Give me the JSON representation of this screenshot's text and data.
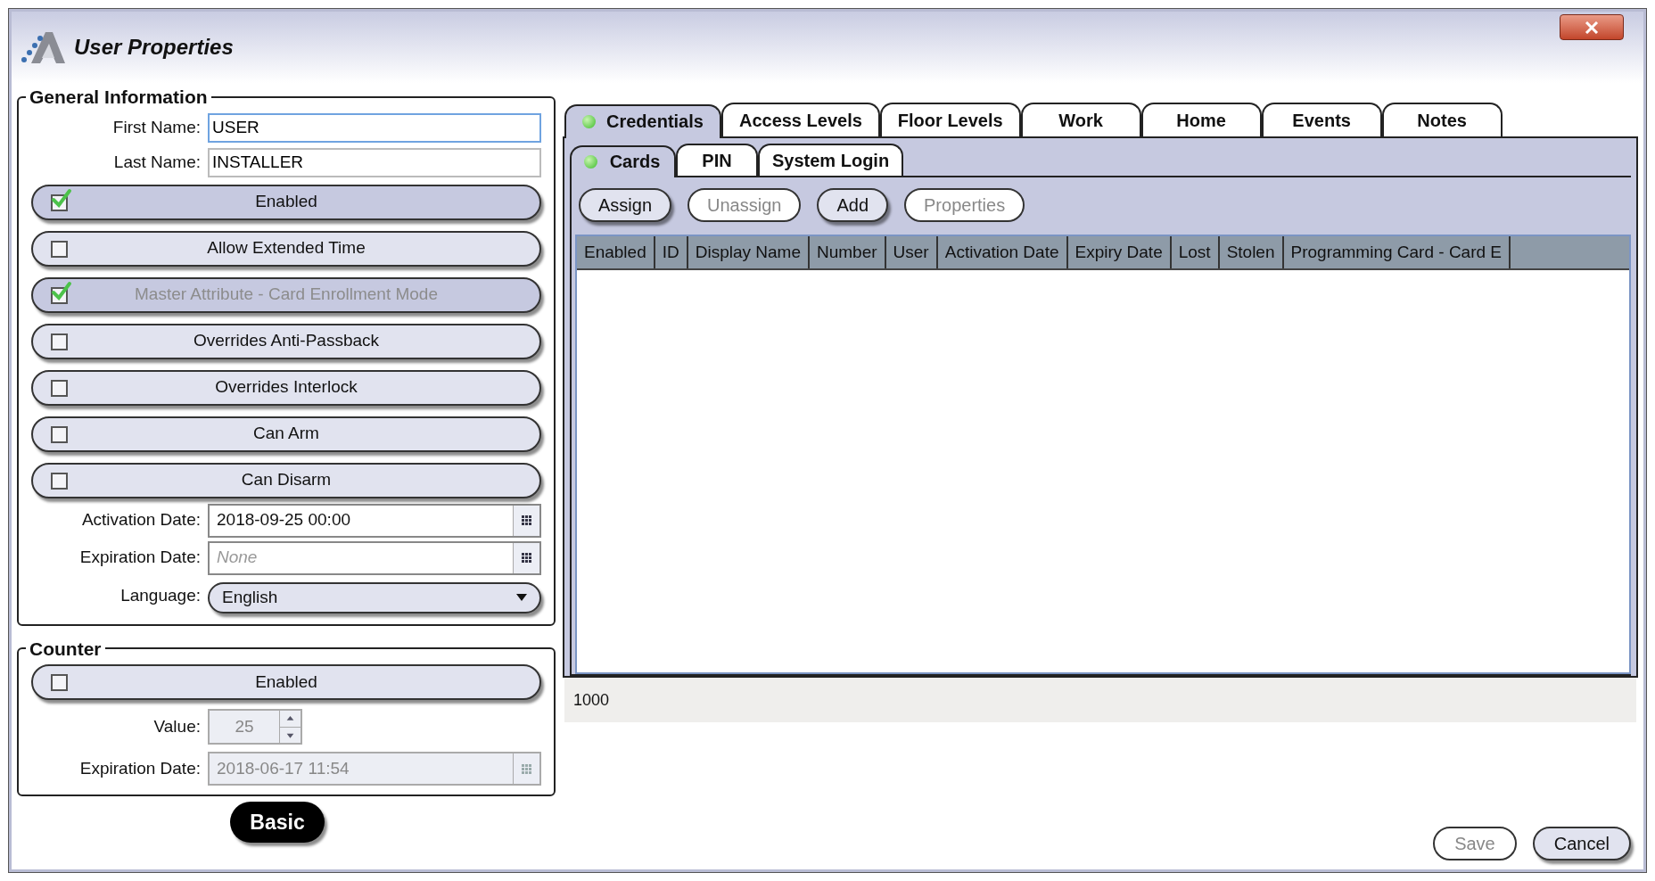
{
  "window": {
    "title": "User Properties"
  },
  "general_information": {
    "title": "General Information",
    "first_name": {
      "label": "First Name:",
      "value": "USER",
      "focused": true
    },
    "last_name": {
      "label": "Last Name:",
      "value": "INSTALLER",
      "focused": false
    },
    "toggles": [
      {
        "label": "Enabled",
        "checked": true,
        "disabled": false
      },
      {
        "label": "Allow Extended Time",
        "checked": false,
        "disabled": false
      },
      {
        "label": "Master Attribute - Card Enrollment Mode",
        "checked": true,
        "disabled": true
      },
      {
        "label": "Overrides Anti-Passback",
        "checked": false,
        "disabled": false
      },
      {
        "label": "Overrides Interlock",
        "checked": false,
        "disabled": false
      },
      {
        "label": "Can Arm",
        "checked": false,
        "disabled": false
      },
      {
        "label": "Can Disarm",
        "checked": false,
        "disabled": false
      }
    ],
    "activation_date": {
      "label": "Activation Date:",
      "value": "2018-09-25 00:00",
      "disabled": false
    },
    "expiration_date": {
      "label": "Expiration Date:",
      "placeholder": "None",
      "disabled": false
    },
    "language": {
      "label": "Language:",
      "value": "English"
    }
  },
  "counter": {
    "title": "Counter",
    "toggle": {
      "label": "Enabled",
      "checked": false,
      "disabled": false
    },
    "value": {
      "label": "Value:",
      "value": "25",
      "disabled": true
    },
    "expiration_date": {
      "label": "Expiration Date:",
      "value": "2018-06-17 11:54",
      "disabled": true
    }
  },
  "mode_button": {
    "label": "Basic"
  },
  "tabs": [
    {
      "label": "Credentials",
      "selected": true
    },
    {
      "label": "Access Levels",
      "selected": false
    },
    {
      "label": "Floor Levels",
      "selected": false
    },
    {
      "label": "Work",
      "selected": false
    },
    {
      "label": "Home",
      "selected": false
    },
    {
      "label": "Events",
      "selected": false
    },
    {
      "label": "Notes",
      "selected": false
    }
  ],
  "subtabs": [
    {
      "label": "Cards",
      "selected": true
    },
    {
      "label": "PIN",
      "selected": false
    },
    {
      "label": "System Login",
      "selected": false
    }
  ],
  "card_actions": [
    {
      "label": "Assign",
      "disabled": false
    },
    {
      "label": "Unassign",
      "disabled": true
    },
    {
      "label": "Add",
      "disabled": false
    },
    {
      "label": "Properties",
      "disabled": true
    }
  ],
  "table": {
    "columns": [
      "Enabled",
      "ID",
      "Display Name",
      "Number",
      "User",
      "Activation Date",
      "Expiry Date",
      "Lost",
      "Stolen",
      "Programming Card - Card E"
    ]
  },
  "status_bar": {
    "count": "1000"
  },
  "buttons": [
    {
      "label": "Save",
      "disabled": true
    },
    {
      "label": "Cancel",
      "disabled": false
    }
  ]
}
